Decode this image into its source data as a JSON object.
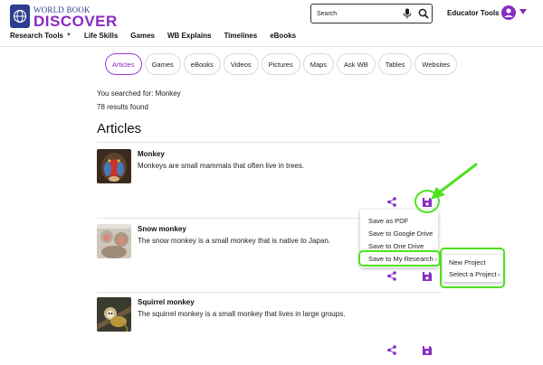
{
  "header": {
    "logo_top": "WORLD BOOK",
    "logo_bottom": "DISCOVER",
    "search_placeholder": "Search",
    "educator_tools": "Educator Tools"
  },
  "nav": [
    {
      "label": "Research Tools",
      "caret": "▼"
    },
    {
      "label": "Life Skills"
    },
    {
      "label": "Games"
    },
    {
      "label": "WB Explains"
    },
    {
      "label": "Timelines"
    },
    {
      "label": "eBooks"
    }
  ],
  "tabs": [
    "Articles",
    "Games",
    "eBooks",
    "Videos",
    "Pictures",
    "Maps",
    "Ask WB",
    "Tables",
    "Websites"
  ],
  "active_tab": "Articles",
  "search_info": {
    "searched_for": "You searched for: Monkey",
    "results_found": "78 results found"
  },
  "section_title": "Articles",
  "results": [
    {
      "title": "Monkey",
      "description": "Monkeys are small mammals that often live in trees."
    },
    {
      "title": "Snow monkey",
      "description": "The snow monkey is a small monkey that is native to Japan."
    },
    {
      "title": "Squirrel monkey",
      "description": "The squirrel monkey is a small monkey that lives in large groups."
    }
  ],
  "save_menu": {
    "items": [
      "Save as PDF",
      "Save to Google Drive",
      "Save to One Drive",
      "Save to My Research"
    ],
    "submenu_arrow": "›"
  },
  "submenu": {
    "items": [
      "New Project",
      "Select a Project"
    ],
    "arrow": "›"
  },
  "colors": {
    "brand_purple": "#8a2bc2",
    "brand_blue": "#2c3e8f",
    "highlight_green": "#4ee21d"
  },
  "icons": {
    "search": "magnifier-icon",
    "mic": "microphone-icon",
    "share": "share-icon",
    "save": "floppy-save-icon",
    "user": "user-avatar-icon"
  }
}
